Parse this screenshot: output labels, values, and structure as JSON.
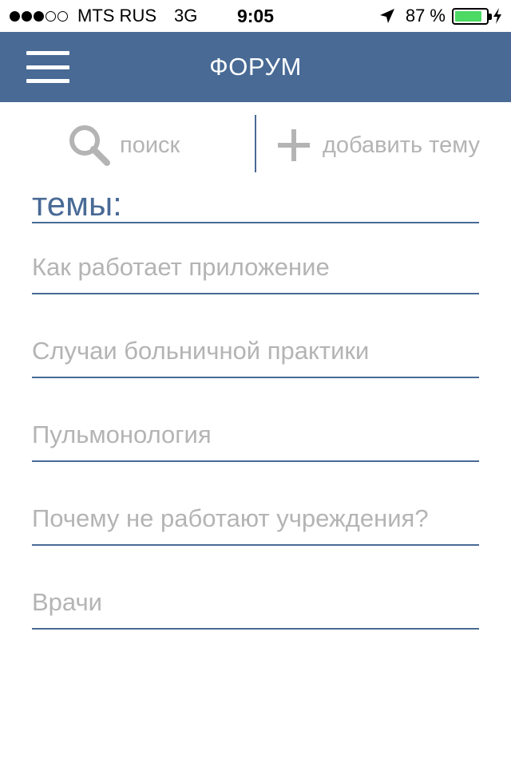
{
  "status_bar": {
    "carrier": "MTS RUS",
    "network": "3G",
    "time": "9:05",
    "battery_percent": "87 %",
    "battery_level": 0.87,
    "battery_color": "#4cd964"
  },
  "nav": {
    "title": "ФОРУМ",
    "menu_icon": "hamburger-menu-icon",
    "background_color": "#486a95"
  },
  "actions": {
    "search_label": "поиск",
    "search_icon": "search-icon",
    "add_label": "добавить тему",
    "add_icon": "plus-icon"
  },
  "topics": {
    "heading": "темы:",
    "items": [
      "Как работает приложение",
      "Случаи больничной практики",
      "Пульмонология",
      "Почему не работают учреждения?",
      "Врачи"
    ]
  }
}
